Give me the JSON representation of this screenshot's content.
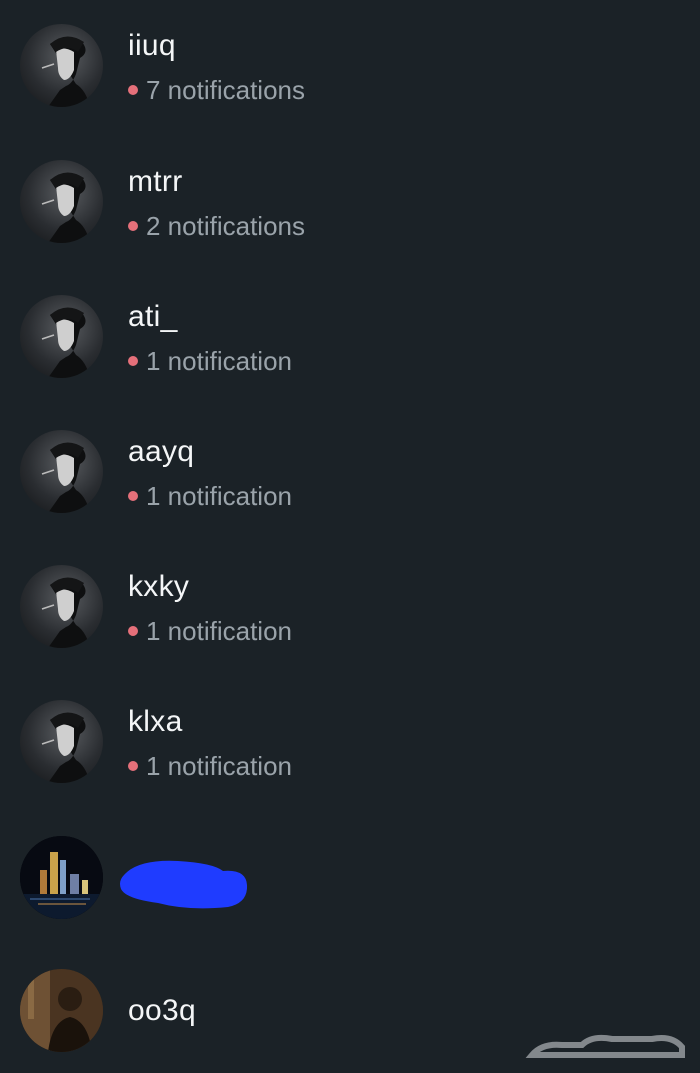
{
  "accounts": [
    {
      "username": "iiuq",
      "notifications": "7 notifications",
      "avatar": "anime-profile-avatar"
    },
    {
      "username": "mtrr",
      "notifications": "2 notifications",
      "avatar": "anime-profile-avatar"
    },
    {
      "username": "ati_",
      "notifications": "1 notification",
      "avatar": "anime-profile-avatar"
    },
    {
      "username": "aayq",
      "notifications": "1 notification",
      "avatar": "anime-profile-avatar"
    },
    {
      "username": "kxky",
      "notifications": "1 notification",
      "avatar": "anime-profile-avatar"
    },
    {
      "username": "klxa",
      "notifications": "1 notification",
      "avatar": "anime-profile-avatar"
    },
    {
      "username": "",
      "notifications": "",
      "avatar": "city-night-avatar"
    },
    {
      "username": "oo3q",
      "notifications": "",
      "avatar": "person-photo-avatar"
    }
  ],
  "colors": {
    "background": "#1b2227",
    "notification_dot": "#e5707a",
    "notification_text": "#9aa3aa",
    "redaction": "#1f3cff"
  },
  "watermark": "حراج"
}
